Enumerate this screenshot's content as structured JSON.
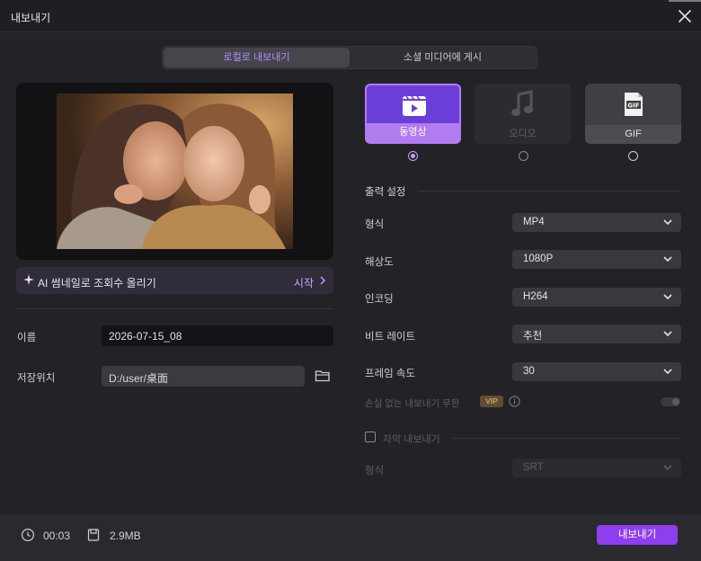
{
  "window": {
    "title": "내보내기"
  },
  "tabs": [
    {
      "label": "로컬로 내보내기",
      "active": true
    },
    {
      "label": "소셜 미디어에 게시",
      "active": false
    }
  ],
  "ai_bar": {
    "label": "AI 썸네일로 조회수 올리기",
    "action": "시작"
  },
  "name": {
    "label": "이름",
    "value": "2026-07-15_08"
  },
  "save_location": {
    "label": "저장위치",
    "value": "D:/user/桌面"
  },
  "output_types": [
    {
      "label": "동영상",
      "selected": true,
      "icon": "film-icon"
    },
    {
      "label": "오디오",
      "selected": false,
      "icon": "music-note-icon"
    },
    {
      "label": "GIF",
      "selected": false,
      "icon": "gif-icon"
    }
  ],
  "output_settings": {
    "title": "출력 설정",
    "rows": [
      {
        "label": "형식",
        "value": "MP4"
      },
      {
        "label": "해상도",
        "value": "1080P"
      },
      {
        "label": "인코딩",
        "value": "H264"
      },
      {
        "label": "비트 레이트",
        "value": "추천"
      },
      {
        "label": "프레임 속도",
        "value": "30"
      }
    ],
    "lossless": {
      "label": "손실 없는 내보내기 무한",
      "badge": "VIP",
      "enabled": false
    },
    "subtitle": {
      "label": "자막 내보내기",
      "checked": false
    },
    "subtitle_format": {
      "label": "형식",
      "value": "SRT"
    }
  },
  "footer": {
    "duration": "00:03",
    "size": "2.9MB",
    "export_label": "내보내기"
  },
  "colors": {
    "accent": "#8f3df0",
    "accent_light": "#c79cff",
    "background": "#232327"
  }
}
